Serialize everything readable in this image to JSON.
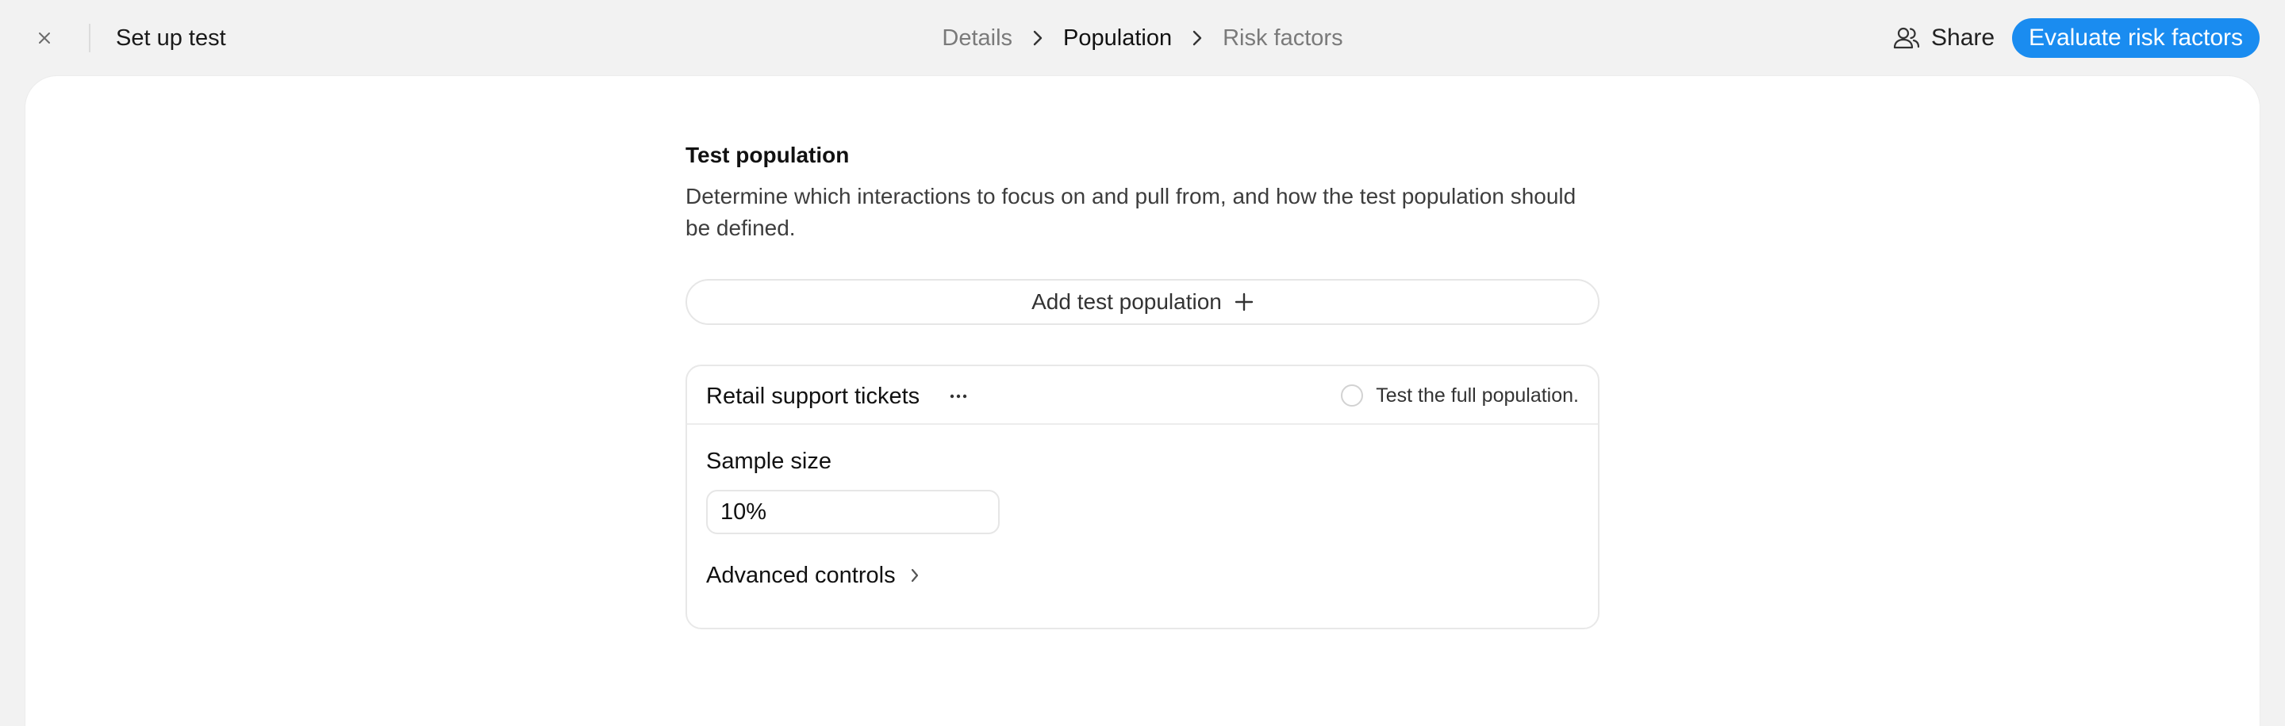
{
  "header": {
    "title": "Set up test",
    "breadcrumb": [
      {
        "label": "Details",
        "active": false
      },
      {
        "label": "Population",
        "active": true
      },
      {
        "label": "Risk factors",
        "active": false
      }
    ],
    "share_label": "Share",
    "primary_label": "Evaluate risk factors"
  },
  "section": {
    "title": "Test population",
    "description": "Determine which interactions to focus on and pull from, and how the test population should be defined.",
    "add_label": "Add test population"
  },
  "population": {
    "name": "Retail support tickets",
    "full_population_label": "Test the full population.",
    "sample_size_label": "Sample size",
    "sample_size_value": "10%",
    "advanced_label": "Advanced controls"
  },
  "colors": {
    "accent": "#1a8cf0",
    "background": "#f2f2f2",
    "card": "#ffffff"
  },
  "icons": {
    "close": "close-icon",
    "chevron": "chevron-right-icon",
    "share": "users-icon",
    "plus": "plus-icon",
    "more": "ellipsis-icon"
  }
}
